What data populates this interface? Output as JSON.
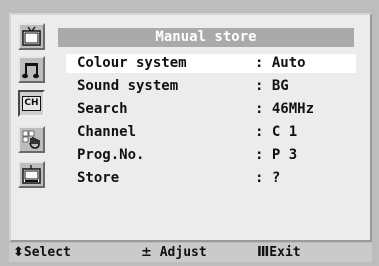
{
  "menu": {
    "title": "Manual store",
    "rows": [
      {
        "label": "Colour system",
        "value": ": Auto",
        "selected": true
      },
      {
        "label": "Sound system",
        "value": ": BG"
      },
      {
        "label": "Search",
        "value": ": 46MHz"
      },
      {
        "label": "Channel",
        "value": ": C 1"
      },
      {
        "label": "Prog.No.",
        "value": ": P 3"
      },
      {
        "label": "Store",
        "value": ": ?"
      }
    ]
  },
  "sidebar": {
    "items": [
      {
        "icon": "picture-tv-icon"
      },
      {
        "icon": "sound-note-icon"
      },
      {
        "icon": "channel-icon",
        "text": "CH",
        "active": true
      },
      {
        "icon": "function-hand-icon"
      },
      {
        "icon": "setup-tv-icon"
      }
    ]
  },
  "footer": {
    "select_glyph": "⬍",
    "select_label": "Select",
    "adjust_glyph": "±",
    "adjust_label": "Adjust",
    "exit_glyph": "Ⅲ",
    "exit_label": "Exit"
  }
}
